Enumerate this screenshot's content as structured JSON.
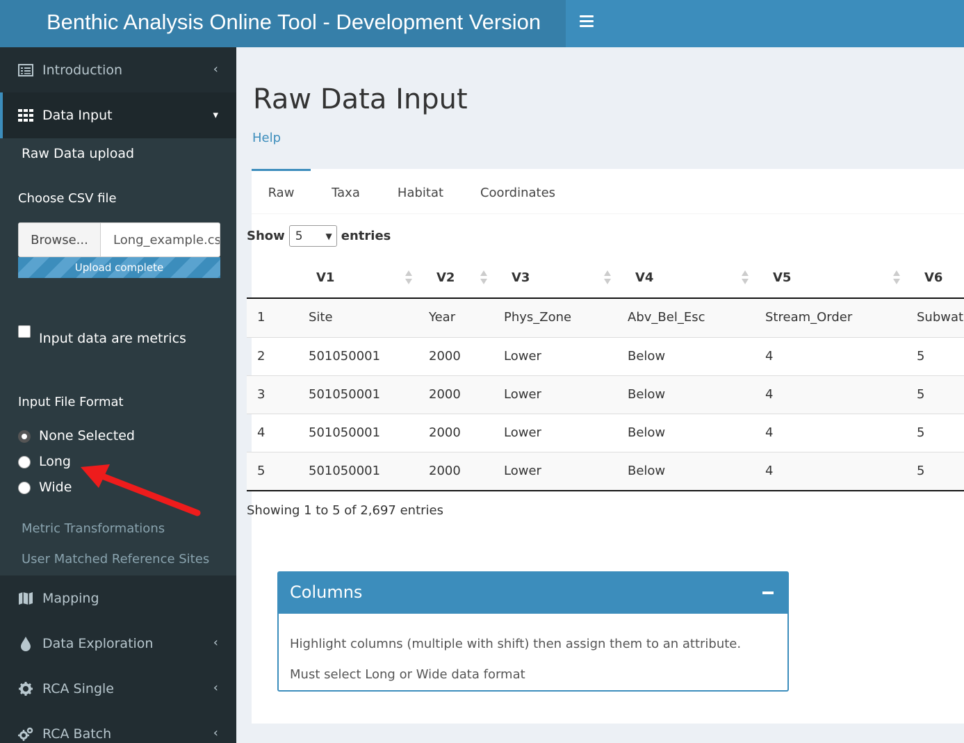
{
  "app": {
    "title": "Benthic Analysis Online Tool - Development Version"
  },
  "sidebar": {
    "items": [
      {
        "label": "Introduction",
        "icon": "list-alt-icon"
      },
      {
        "label": "Data Input",
        "icon": "table-icon"
      },
      {
        "label": "Mapping",
        "icon": "map-icon"
      },
      {
        "label": "Data Exploration",
        "icon": "tint-icon"
      },
      {
        "label": "RCA Single",
        "icon": "gear-icon"
      },
      {
        "label": "RCA Batch",
        "icon": "gears-icon"
      }
    ],
    "submenu": {
      "raw_upload": "Raw Data upload",
      "choose_csv": "Choose CSV file",
      "browse_label": "Browse...",
      "file_name": "Long_example.csv",
      "upload_status": "Upload complete",
      "upload_progress": 100,
      "metrics_checkbox": "Input data are metrics",
      "metrics_checked": false,
      "format_label": "Input File Format",
      "format_options": [
        "None Selected",
        "Long",
        "Wide"
      ],
      "format_selected": "None Selected",
      "metric_transformations": "Metric Transformations",
      "user_matched": "User Matched Reference Sites"
    }
  },
  "main": {
    "title": "Raw Data Input",
    "help": "Help",
    "tabs": [
      "Raw",
      "Taxa",
      "Habitat",
      "Coordinates"
    ],
    "active_tab": "Raw",
    "show_label": "Show",
    "entries_label": "entries",
    "page_length": "5",
    "table": {
      "columns": [
        "",
        "V1",
        "V2",
        "V3",
        "V4",
        "V5",
        "V6"
      ],
      "rows": [
        [
          "1",
          "Site",
          "Year",
          "Phys_Zone",
          "Abv_Bel_Esc",
          "Stream_Order",
          "Subwatershed"
        ],
        [
          "2",
          "501050001",
          "2000",
          "Lower",
          "Below",
          "4",
          "5"
        ],
        [
          "3",
          "501050001",
          "2000",
          "Lower",
          "Below",
          "4",
          "5"
        ],
        [
          "4",
          "501050001",
          "2000",
          "Lower",
          "Below",
          "4",
          "5"
        ],
        [
          "5",
          "501050001",
          "2000",
          "Lower",
          "Below",
          "4",
          "5"
        ]
      ]
    },
    "info": "Showing 1 to 5 of 2,697 entries"
  },
  "columns_box": {
    "title": "Columns",
    "line1": "Highlight columns (multiple with shift) then assign them to an attribute.",
    "line2": "Must select Long or Wide data format"
  },
  "colors": {
    "primary": "#3c8dbc",
    "header_logo": "#367fa9",
    "sidebar": "#222d32",
    "sidebar_sub": "#2c3b41",
    "annotation_arrow": "#ee1c1c"
  }
}
